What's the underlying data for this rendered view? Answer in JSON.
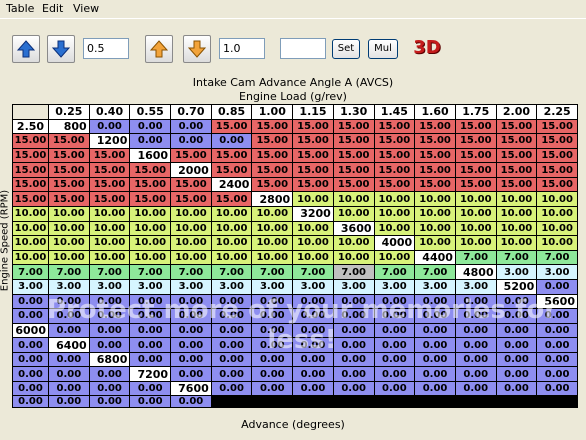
{
  "menu": [
    "Table",
    "Edit",
    "View"
  ],
  "toolbar": {
    "step1": "0.5",
    "step2": "1.0",
    "value": "",
    "set_label": "Set",
    "mul_label": "Mul",
    "three_d_label": "3D"
  },
  "table": {
    "title": "Intake Cam Advance Angle A (AVCS)",
    "x_label": "Engine Load (g/rev)",
    "y_label": "Engine Speed (RPM)",
    "footer": "Advance (degrees)",
    "columns": [
      "0.25",
      "0.40",
      "0.55",
      "0.70",
      "0.85",
      "1.00",
      "1.15",
      "1.30",
      "1.45",
      "1.60",
      "1.75",
      "2.00",
      "2.25",
      "2.50"
    ],
    "rows": [
      {
        "rpm": "800",
        "values": [
          "0.00",
          "0.00",
          "0.00",
          "15.00",
          "15.00",
          "15.00",
          "15.00",
          "15.00",
          "15.00",
          "15.00",
          "15.00",
          "15.00",
          "15.00",
          "15.00"
        ]
      },
      {
        "rpm": "1200",
        "values": [
          "0.00",
          "0.00",
          "0.00",
          "15.00",
          "15.00",
          "15.00",
          "15.00",
          "15.00",
          "15.00",
          "15.00",
          "15.00",
          "15.00",
          "15.00",
          "15.00"
        ]
      },
      {
        "rpm": "1600",
        "values": [
          "15.00",
          "15.00",
          "15.00",
          "15.00",
          "15.00",
          "15.00",
          "15.00",
          "15.00",
          "15.00",
          "15.00",
          "15.00",
          "15.00",
          "15.00",
          "15.00"
        ]
      },
      {
        "rpm": "2000",
        "values": [
          "15.00",
          "15.00",
          "15.00",
          "15.00",
          "15.00",
          "15.00",
          "15.00",
          "15.00",
          "15.00",
          "15.00",
          "15.00",
          "15.00",
          "15.00",
          "15.00"
        ]
      },
      {
        "rpm": "2400",
        "values": [
          "15.00",
          "15.00",
          "15.00",
          "15.00",
          "15.00",
          "15.00",
          "15.00",
          "15.00",
          "15.00",
          "15.00",
          "15.00",
          "15.00",
          "15.00",
          "15.00"
        ]
      },
      {
        "rpm": "2800",
        "values": [
          "10.00",
          "10.00",
          "10.00",
          "10.00",
          "10.00",
          "10.00",
          "10.00",
          "10.00",
          "10.00",
          "10.00",
          "10.00",
          "10.00",
          "10.00",
          "10.00"
        ]
      },
      {
        "rpm": "3200",
        "values": [
          "10.00",
          "10.00",
          "10.00",
          "10.00",
          "10.00",
          "10.00",
          "10.00",
          "10.00",
          "10.00",
          "10.00",
          "10.00",
          "10.00",
          "10.00",
          "10.00"
        ]
      },
      {
        "rpm": "3600",
        "values": [
          "10.00",
          "10.00",
          "10.00",
          "10.00",
          "10.00",
          "10.00",
          "10.00",
          "10.00",
          "10.00",
          "10.00",
          "10.00",
          "10.00",
          "10.00",
          "10.00"
        ]
      },
      {
        "rpm": "4000",
        "values": [
          "10.00",
          "10.00",
          "10.00",
          "10.00",
          "10.00",
          "10.00",
          "10.00",
          "10.00",
          "10.00",
          "10.00",
          "10.00",
          "10.00",
          "10.00",
          "10.00"
        ]
      },
      {
        "rpm": "4400",
        "values": [
          "7.00",
          "7.00",
          "7.00",
          "7.00",
          "7.00",
          "7.00",
          "7.00",
          "7.00",
          "7.00",
          "7.00",
          "7.00",
          "7.00",
          "7.00",
          "7.00"
        ]
      },
      {
        "rpm": "4800",
        "values": [
          "3.00",
          "3.00",
          "3.00",
          "3.00",
          "3.00",
          "3.00",
          "3.00",
          "3.00",
          "3.00",
          "3.00",
          "3.00",
          "3.00",
          "3.00",
          "3.00"
        ]
      },
      {
        "rpm": "5200",
        "values": [
          "0.00",
          "0.00",
          "0.00",
          "0.00",
          "0.00",
          "0.00",
          "0.00",
          "0.00",
          "0.00",
          "0.00",
          "0.00",
          "0.00",
          "0.00",
          "0.00"
        ]
      },
      {
        "rpm": "5600",
        "values": [
          "0.00",
          "0.00",
          "0.00",
          "0.00",
          "0.00",
          "0.00",
          "0.00",
          "0.00",
          "0.00",
          "0.00",
          "0.00",
          "0.00",
          "0.00",
          "0.00"
        ]
      },
      {
        "rpm": "6000",
        "values": [
          "0.00",
          "0.00",
          "0.00",
          "0.00",
          "0.00",
          "0.00",
          "0.00",
          "0.00",
          "0.00",
          "0.00",
          "0.00",
          "0.00",
          "0.00",
          "0.00"
        ]
      },
      {
        "rpm": "6400",
        "values": [
          "0.00",
          "0.00",
          "0.00",
          "0.00",
          "0.00",
          "0.00",
          "0.00",
          "0.00",
          "0.00",
          "0.00",
          "0.00",
          "0.00",
          "0.00",
          "0.00"
        ]
      },
      {
        "rpm": "6800",
        "values": [
          "0.00",
          "0.00",
          "0.00",
          "0.00",
          "0.00",
          "0.00",
          "0.00",
          "0.00",
          "0.00",
          "0.00",
          "0.00",
          "0.00",
          "0.00",
          "0.00"
        ]
      },
      {
        "rpm": "7200",
        "values": [
          "0.00",
          "0.00",
          "0.00",
          "0.00",
          "0.00",
          "0.00",
          "0.00",
          "0.00",
          "0.00",
          "0.00",
          "0.00",
          "0.00",
          "0.00",
          "0.00"
        ]
      },
      {
        "rpm": "7600",
        "values": [
          "0.00",
          "0.00",
          "0.00",
          "0.00",
          "0.00",
          "0.00",
          "0.00",
          "0.00",
          "0.00",
          "0.00",
          "0.00",
          "0.00",
          "0.00",
          "0.00"
        ]
      }
    ]
  },
  "watermark": "Protect more of your memories for less!"
}
